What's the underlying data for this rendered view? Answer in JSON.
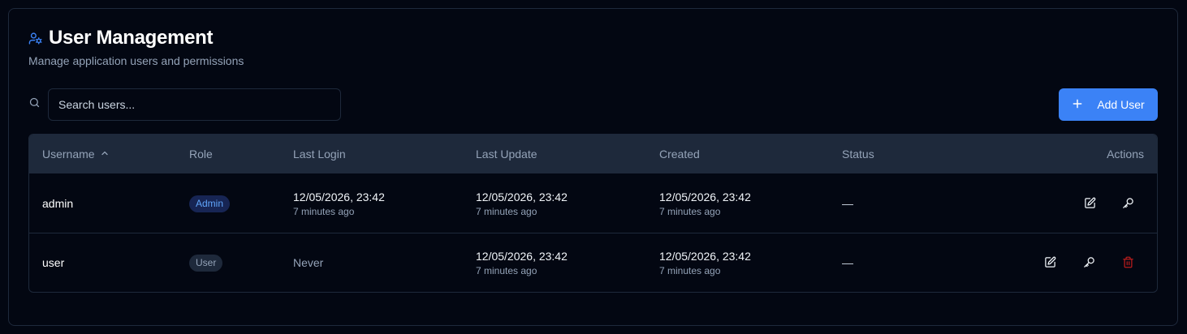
{
  "header": {
    "title": "User Management",
    "subtitle": "Manage application users and permissions",
    "accent_color": "#3b82f6"
  },
  "search": {
    "placeholder": "Search users...",
    "value": ""
  },
  "toolbar": {
    "add_label": "Add User"
  },
  "table": {
    "columns": {
      "username": "Username",
      "role": "Role",
      "last_login": "Last Login",
      "last_update": "Last Update",
      "created": "Created",
      "status": "Status",
      "actions": "Actions"
    },
    "sort": {
      "column": "Username",
      "direction": "ascending"
    },
    "rows": [
      {
        "username": "admin",
        "role": "Admin",
        "last_login": {
          "date": "12/05/2026, 23:42",
          "relative": "7 minutes ago"
        },
        "last_update": {
          "date": "12/05/2026, 23:42",
          "relative": "7 minutes ago"
        },
        "created": {
          "date": "12/05/2026, 23:42",
          "relative": "7 minutes ago"
        },
        "status": "—",
        "actions": [
          "edit-icon",
          "key-icon"
        ]
      },
      {
        "username": "user",
        "role": "User",
        "last_login": "Never",
        "last_update": {
          "date": "12/05/2026, 23:42",
          "relative": "7 minutes ago"
        },
        "created": {
          "date": "12/05/2026, 23:42",
          "relative": "7 minutes ago"
        },
        "status": "—",
        "actions": [
          "edit-icon",
          "key-icon",
          "trash-icon"
        ]
      }
    ]
  }
}
